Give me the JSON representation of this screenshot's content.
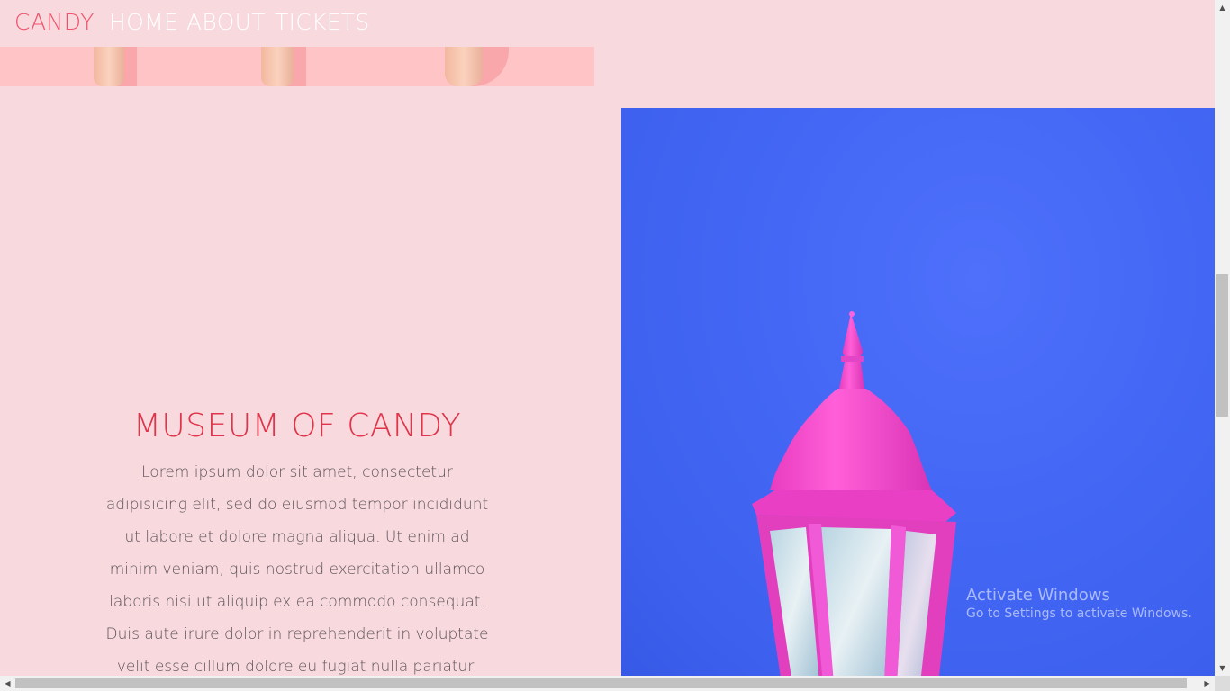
{
  "nav": {
    "brand": "CANDY",
    "links": [
      {
        "label": "HOME"
      },
      {
        "label": "ABOUT"
      },
      {
        "label": "TICKETS"
      }
    ]
  },
  "intro": {
    "title": "MUSEUM OF CANDY",
    "body": "Lorem ipsum dolor sit amet, consectetur adipisicing elit, sed do eiusmod tempor incididunt ut labore et dolore magna aliqua. Ut enim ad minim veniam, quis nostrud exercitation ullamco laboris nisi ut aliquip ex ea commodo consequat. Duis aute irure dolor in reprehenderit in voluptate velit esse cillum dolore eu fugiat nulla pariatur."
  },
  "watermark": {
    "title": "Activate Windows",
    "subtitle": "Go to Settings to activate Windows."
  },
  "colors": {
    "background": "#f7d9de",
    "brand": "#f0506a",
    "title": "#e0344a",
    "photo_blue": "#4468f5",
    "lamp_pink": "#ff4fd0"
  },
  "icons": {
    "scroll_up": "triangle-up-icon",
    "scroll_down": "triangle-down-icon",
    "scroll_left": "triangle-left-icon",
    "scroll_right": "triangle-right-icon"
  }
}
